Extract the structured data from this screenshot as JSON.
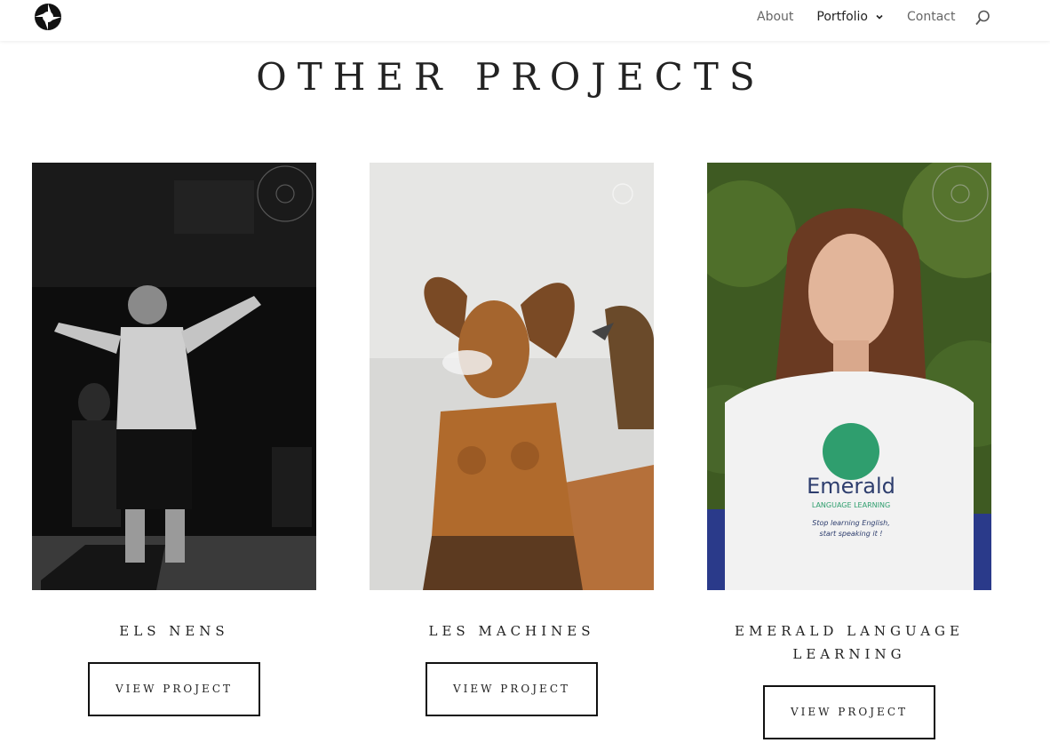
{
  "header": {
    "logo_icon": "aperture-logo-icon",
    "nav": {
      "about": "About",
      "portfolio": "Portfolio",
      "contact": "Contact"
    },
    "search_icon": "search-icon"
  },
  "page": {
    "title": "OTHER PROJECTS"
  },
  "projects": [
    {
      "title": "ELS NENS",
      "button": "VIEW PROJECT",
      "image": "black-and-white concert performer photo"
    },
    {
      "title": "LES MACHINES",
      "button": "VIEW PROJECT",
      "image": "giant mechanical horned statue photo"
    },
    {
      "title": "EMERALD LANGUAGE LEARNING",
      "button": "VIEW PROJECT",
      "image": "portrait of woman in Emerald t-shirt"
    }
  ],
  "tshirt": {
    "brand": "Emerald",
    "sub": "LANGUAGE LEARNING",
    "tagline1": "Stop learning English,",
    "tagline2": "start speaking it !"
  },
  "colors": {
    "accent": "#222222",
    "nav_muted": "#666666",
    "emerald": "#2f9e6e"
  }
}
